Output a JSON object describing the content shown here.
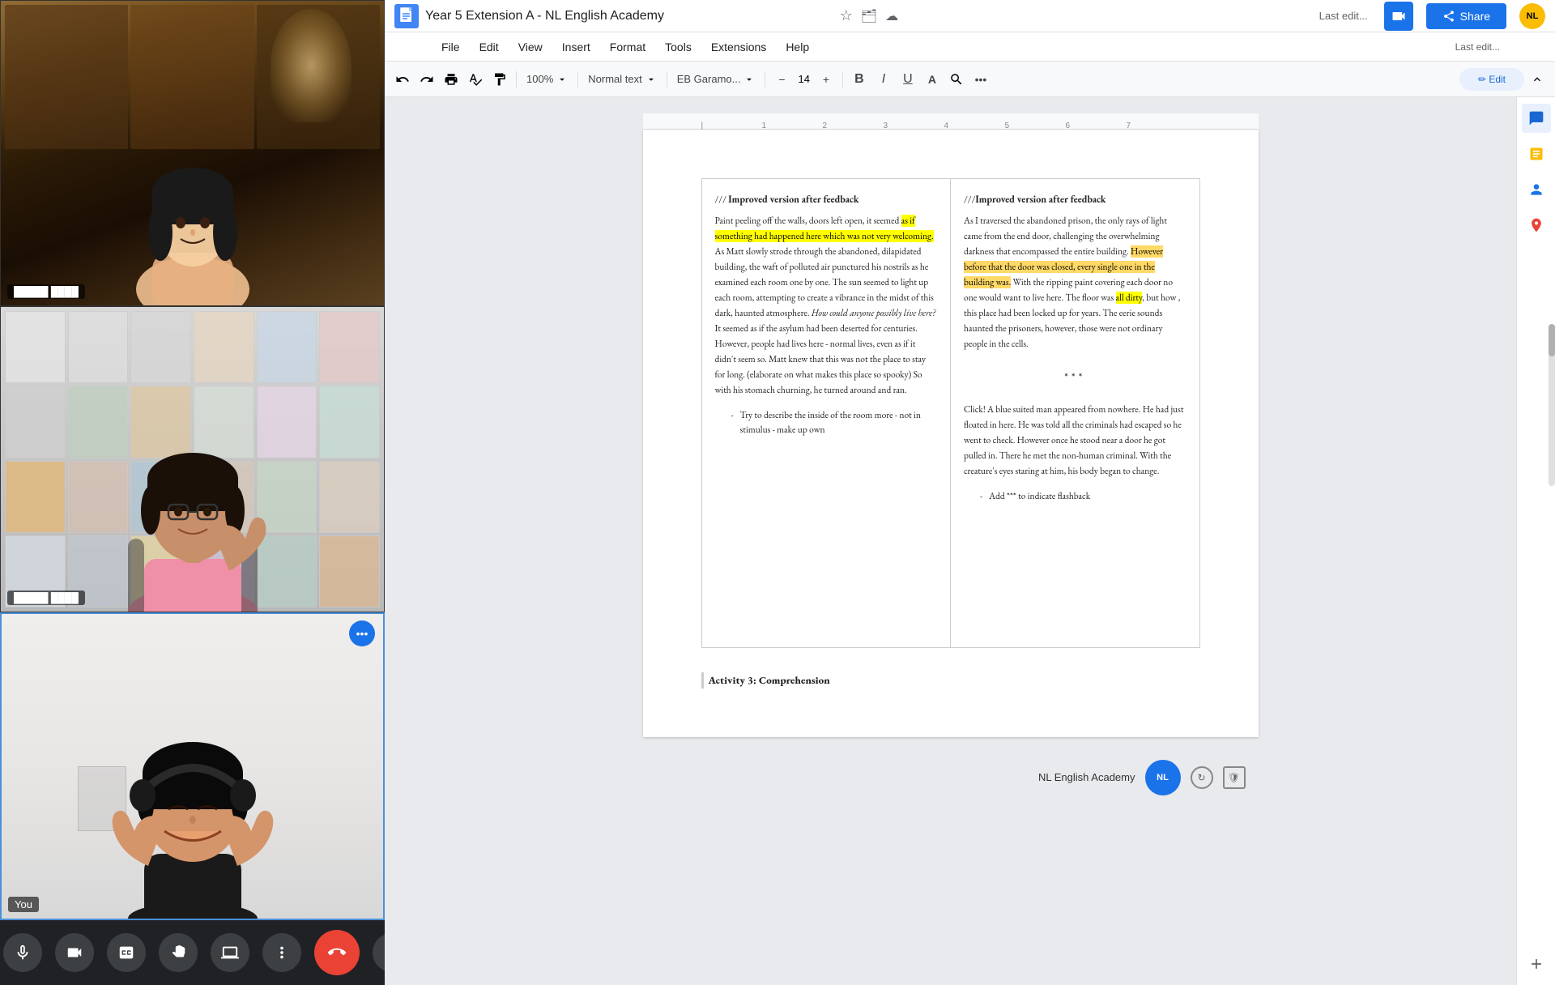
{
  "app": {
    "title": "Year 5 Extension A - NL English Academy",
    "doc_icon": "📄"
  },
  "title_bar": {
    "title": "Year 5 Extension A - NL English Academy",
    "star_icon": "☆",
    "share_label": "Share",
    "last_edit": "Last edit..."
  },
  "menu": {
    "items": [
      "File",
      "Edit",
      "View",
      "Insert",
      "Format",
      "Tools",
      "Extensions",
      "Help"
    ]
  },
  "toolbar": {
    "undo": "↩",
    "redo": "↪",
    "print": "🖨",
    "spell": "✓",
    "paint": "🖌",
    "zoom": "100%",
    "style": "Normal text",
    "font": "EB Garamo...",
    "font_size": "14",
    "bold": "B",
    "italic": "I",
    "underline": "U",
    "more": "..."
  },
  "document": {
    "col1": {
      "header": "/// Improved version after feedback",
      "paragraphs": [
        "Paint peeling off the walls, doors left open, it seemed as if something had happened here which was not very welcoming. As Matt slowly strode through the abandoned, dilapidated building, the waft of polluted air punctured his nostrils as he examined each room one by one. The sun seemed to light up each room, attempting to create a vibrance in the midst of this dark, haunted atmosphere. How could anyone possibly live here? It seemed as if the asylum had been deserted for centuries. However, people had lives here - normal lives, even as if it didn't seem so. Matt knew that this was not the place to stay for long. (elaborate on what makes this place so spooky) So with his stomach churning, he turned around and ran."
      ],
      "bullets": [
        "Try to describe the inside of the room more - not in stimulus - make up own"
      ],
      "highlight1_start": "as if something had happened here which was not very welcoming",
      "italic_part": "How could anyone possibly live here?"
    },
    "col2": {
      "header": "///Improved version after feedback",
      "paragraph1": "As I traversed the abandoned prison, the only rays of light came from the end door, challenging the overwhelming darkness that encompassed the entire building. However before that the door was closed, every single one in the building was. With the ripping paint covering each door no one would want to live here. The floor was all dirty, but how , this place had been locked up for years. The eerie sounds haunted the prisoners, however, those were not ordinary people in the cells.",
      "separator": "***",
      "paragraph2": "Click! A blue suited man appeared from nowhere. He had just floated in here. He was told all the criminals had escaped so he went to check. However once he stood near a door he got pulled in. There he met the non-human criminal. With the creature's eyes staring at him, his body began to change.",
      "bullet": "Add *** to indicate flashback",
      "highlight1": "However before that the door was closed, every single one in the building was",
      "highlight2": "all dirty"
    },
    "activity": {
      "title": "Activity 3: Comprehension"
    },
    "footer": {
      "academy": "NL English Academy"
    }
  },
  "video": {
    "participants": [
      {
        "name": "Participant 1",
        "show_name": false
      },
      {
        "name": "Participant 2",
        "show_name": false
      },
      {
        "name": "You",
        "show_name": true
      }
    ]
  },
  "controls": {
    "mic": "🎤",
    "camera": "📷",
    "captions": "CC",
    "raise_hand": "✋",
    "present": "⬆",
    "more": "⋮",
    "end_call": "📞",
    "chevron": "^"
  },
  "right_sidebar": {
    "icons": [
      "📊",
      "💬",
      "👤",
      "📍",
      "+"
    ]
  }
}
